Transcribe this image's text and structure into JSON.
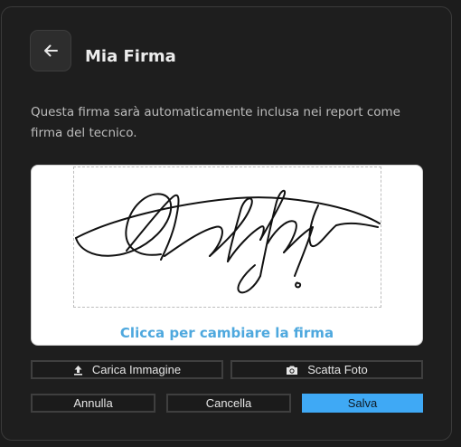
{
  "header": {
    "title": "Mia Firma",
    "back_icon": "arrow-left-icon"
  },
  "description": "Questa firma sarà automaticamente inclusa nei report come firma del tecnico.",
  "signature": {
    "hint": "Clicca per cambiare la firma"
  },
  "actions": {
    "upload_label": "Carica Immagine",
    "upload_icon": "upload-icon",
    "photo_label": "Scatta Foto",
    "photo_icon": "camera-icon"
  },
  "footer": {
    "cancel_label": "Annulla",
    "delete_label": "Cancella",
    "save_label": "Salva"
  },
  "colors": {
    "accent": "#3fa9f5",
    "hint": "#4ea8de",
    "background": "#1e1e1e"
  }
}
